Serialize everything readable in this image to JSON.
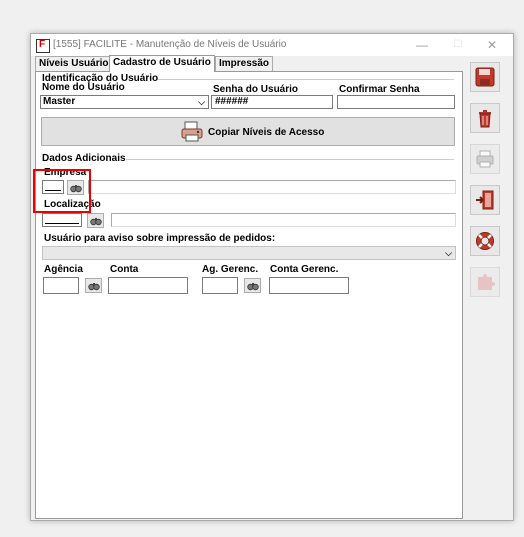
{
  "window": {
    "title": "[1555] FACILITE - Manutenção de Níveis de Usuário",
    "minimize_glyph": "—",
    "maximize_glyph": "☐",
    "close_glyph": "✕"
  },
  "tabs": [
    {
      "label": "Níveis Usuário",
      "active": false
    },
    {
      "label": "Cadastro de Usuário",
      "active": true
    },
    {
      "label": "Impressão",
      "active": false
    }
  ],
  "identificacao": {
    "section_title": "Identificação do Usuário",
    "nome_label": "Nome do Usuário",
    "nome_value": "Master",
    "senha_label": "Senha do Usuário",
    "senha_value": "######",
    "confirmar_label": "Confirmar Senha",
    "confirmar_value": ""
  },
  "copiar_button": {
    "label": "Copiar Níveis de Acesso",
    "icon": "printer-copy-icon"
  },
  "dados": {
    "section_title": "Dados Adicionais",
    "empresa_label": "Empresa",
    "localizacao_label": "Localização",
    "aviso_label": "Usuário para aviso sobre impressão de pedidos:",
    "aviso_value": "",
    "agencia_label": "Agência",
    "conta_label": "Conta",
    "ag_gerenc_label": "Ag. Gerenc.",
    "conta_gerenc_label": "Conta Gerenc."
  },
  "sidebar": [
    {
      "name": "save",
      "icon": "floppy-disk-icon"
    },
    {
      "name": "delete",
      "icon": "trash-can-icon"
    },
    {
      "name": "print",
      "icon": "printer-icon"
    },
    {
      "name": "exit",
      "icon": "exit-door-icon"
    },
    {
      "name": "help",
      "icon": "lifebuoy-icon"
    },
    {
      "name": "extra",
      "icon": "puzzle-icon"
    }
  ],
  "colors": {
    "accent": "#c0392b",
    "highlight_box": "#e00000"
  }
}
